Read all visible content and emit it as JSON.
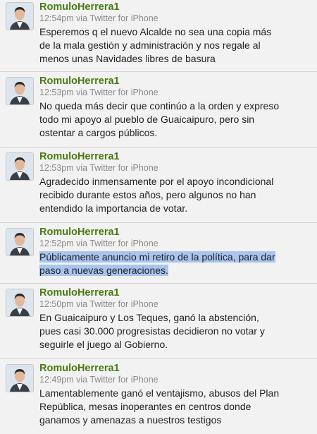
{
  "tweets": [
    {
      "username": "RomuloHerrera1",
      "meta": "12:54pm via Twitter for iPhone",
      "lines": [
        "Esperemos q el nuevo Alcalde no sea una copia más",
        "de la mala gestión y administración y nos regale al",
        "menos unas Navidades libres de basura"
      ]
    },
    {
      "username": "RomuloHerrera1",
      "meta": "12:53pm via Twitter for iPhone",
      "lines": [
        "No queda más decir que continúo a la orden y expreso",
        "todo mi apoyo al pueblo de Guaicaipuro, pero sin",
        "ostentar a cargos públicos."
      ]
    },
    {
      "username": "RomuloHerrera1",
      "meta": "12:53pm via Twitter for iPhone",
      "lines": [
        "Agradecido inmensamente por el apoyo incondicional",
        "recibido durante estos años, pero algunos no han",
        "entendido la importancia de votar."
      ]
    },
    {
      "username": "RomuloHerrera1",
      "meta": "12:52pm via Twitter for iPhone",
      "lines": [
        "Públicamente anuncio mi retiro de la política, para dar",
        "paso a nuevas generaciones."
      ]
    },
    {
      "username": "RomuloHerrera1",
      "meta": "12:50pm via Twitter for iPhone",
      "lines": [
        "En Guaicaipuro y Los Teques, ganó la abstención,",
        "pues casi 30.000 progresistas decidieron no votar y",
        "seguirle el juego al Gobierno."
      ]
    },
    {
      "username": "RomuloHerrera1",
      "meta": "12:49pm via Twitter for iPhone",
      "lines": [
        "Lamentablemente ganó el ventajismo, abusos del Plan",
        "República, mesas inoperantes en centros donde",
        "ganamos y amenazas a nuestros testigos"
      ]
    }
  ],
  "colors": {
    "username": "#4a7a12",
    "meta": "#8a8a8a",
    "selection": "#a9c5ef"
  }
}
